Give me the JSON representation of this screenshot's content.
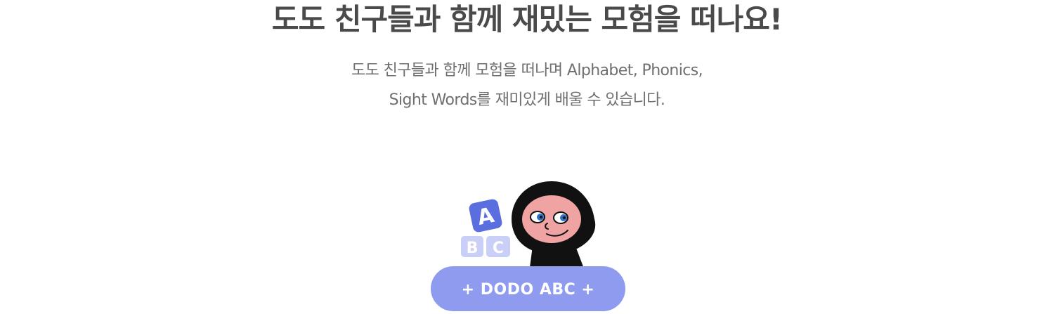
{
  "hero": {
    "title": "도도 친구들과 함께 재밌는 모험을 떠나요!",
    "description_line1": "도도 친구들과 함께 모험을 떠나며 Alphabet, Phonics,",
    "description_line2": "Sight Words를 재미있게 배울 수 있습니다."
  },
  "illustration": {
    "blocks": [
      "A",
      "B",
      "C"
    ],
    "colors": {
      "block_a": "#5b6ee0",
      "block_bc": "#c9cff6",
      "hood": "#111111",
      "face": "#f0a3a3",
      "iris": "#2f6fc7"
    }
  },
  "cta": {
    "label": "+ DODO ABC +",
    "color": "#8e9bef"
  }
}
